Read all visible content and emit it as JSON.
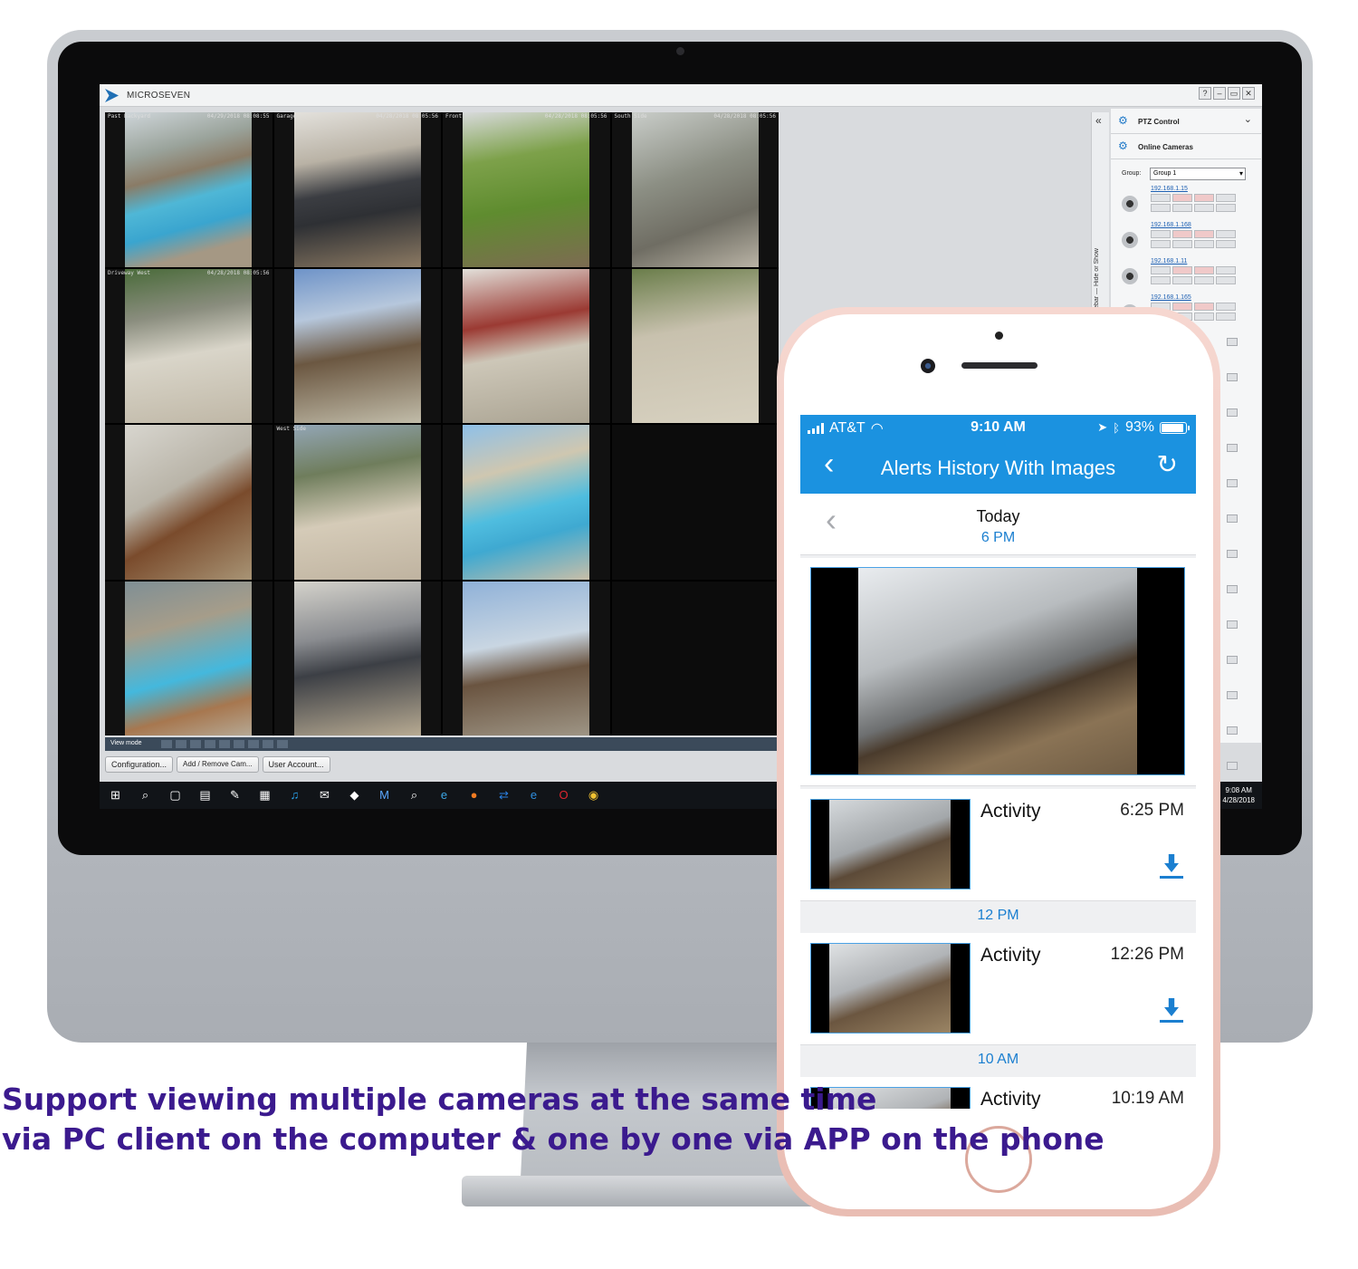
{
  "pc_client": {
    "app_name": "MICROSEVEN",
    "window_controls": [
      "?",
      "–",
      "▭",
      "✕"
    ],
    "camera_tiles": [
      {
        "label": "Past Backyard",
        "timestamp": "04/29/2018 08:08:55",
        "scene": "pool"
      },
      {
        "label": "Garage",
        "timestamp": "04/28/2018 08:05:56",
        "scene": "garage"
      },
      {
        "label": "Front",
        "timestamp": "04/28/2018 08:05:56",
        "scene": "lawn"
      },
      {
        "label": "South Side",
        "timestamp": "04/28/2018 08:05:56",
        "scene": "sideyard"
      },
      {
        "label": "Driveway West",
        "timestamp": "04/28/2018 08:05:56",
        "scene": "driveway"
      },
      {
        "label": "",
        "timestamp": "",
        "scene": "deck"
      },
      {
        "label": "",
        "timestamp": "",
        "scene": "patio"
      },
      {
        "label": "",
        "timestamp": "",
        "scene": "hillside"
      },
      {
        "label": "",
        "timestamp": "",
        "scene": "door"
      },
      {
        "label": "West Side",
        "timestamp": "",
        "scene": "walkway"
      },
      {
        "label": "",
        "timestamp": "",
        "scene": "pool2"
      },
      {
        "label": "",
        "timestamp": "",
        "scene": "empty"
      },
      {
        "label": "",
        "timestamp": "",
        "scene": "pool3"
      },
      {
        "label": "",
        "timestamp": "",
        "scene": "garage2"
      },
      {
        "label": "",
        "timestamp": "",
        "scene": "railing"
      },
      {
        "label": "",
        "timestamp": "",
        "scene": "empty"
      }
    ],
    "view_mode_label": "View mode",
    "buttons": {
      "configuration": "Configuration...",
      "add_remove": "Add / Remove Cam...",
      "user_account": "User Account..."
    },
    "sidebar": {
      "toggle_text": "Sidebar — Hide or Show",
      "ptz_control": "PTZ Control",
      "online_cameras": "Online Cameras",
      "group_label": "Group:",
      "group_value": "Group 1",
      "cameras": [
        "192.168.1.15",
        "192.168.1.168",
        "192.168.1.11",
        "192.168.1.165"
      ]
    },
    "taskbar": {
      "icons": [
        "windows-start-icon",
        "search-icon",
        "task-view-icon",
        "file-explorer-icon",
        "paint-icon",
        "store-icon",
        "twitter-icon",
        "mail-icon",
        "app-icon",
        "microseven-icon",
        "magnifier-icon",
        "ie-icon",
        "firefox-icon",
        "teamviewer-icon",
        "edge-icon",
        "opera-icon",
        "chrome-icon"
      ],
      "time": "9:08 AM",
      "date": "4/28/2018"
    }
  },
  "phone_app": {
    "status": {
      "carrier": "AT&T",
      "time": "9:10 AM",
      "battery": "93%",
      "battery_level": 0.93
    },
    "nav_title": "Alerts History With Images",
    "day_label": "Today",
    "first_hour": "6 PM",
    "alerts": [
      {
        "type": "Activity",
        "time": "6:25 PM",
        "hour_after": "12 PM"
      },
      {
        "type": "Activity",
        "time": "12:26 PM",
        "hour_after": "10 AM"
      },
      {
        "type": "Activity",
        "time": "10:19 AM"
      }
    ]
  },
  "caption": {
    "line1": "Support viewing multiple cameras at the same time",
    "line2": "via PC client on the computer & one by one via APP on the phone"
  },
  "colors": {
    "accent_blue": "#1b92e0",
    "caption_purple": "#3b1a8e",
    "phone_rose_gold": "#e9bdb3"
  }
}
